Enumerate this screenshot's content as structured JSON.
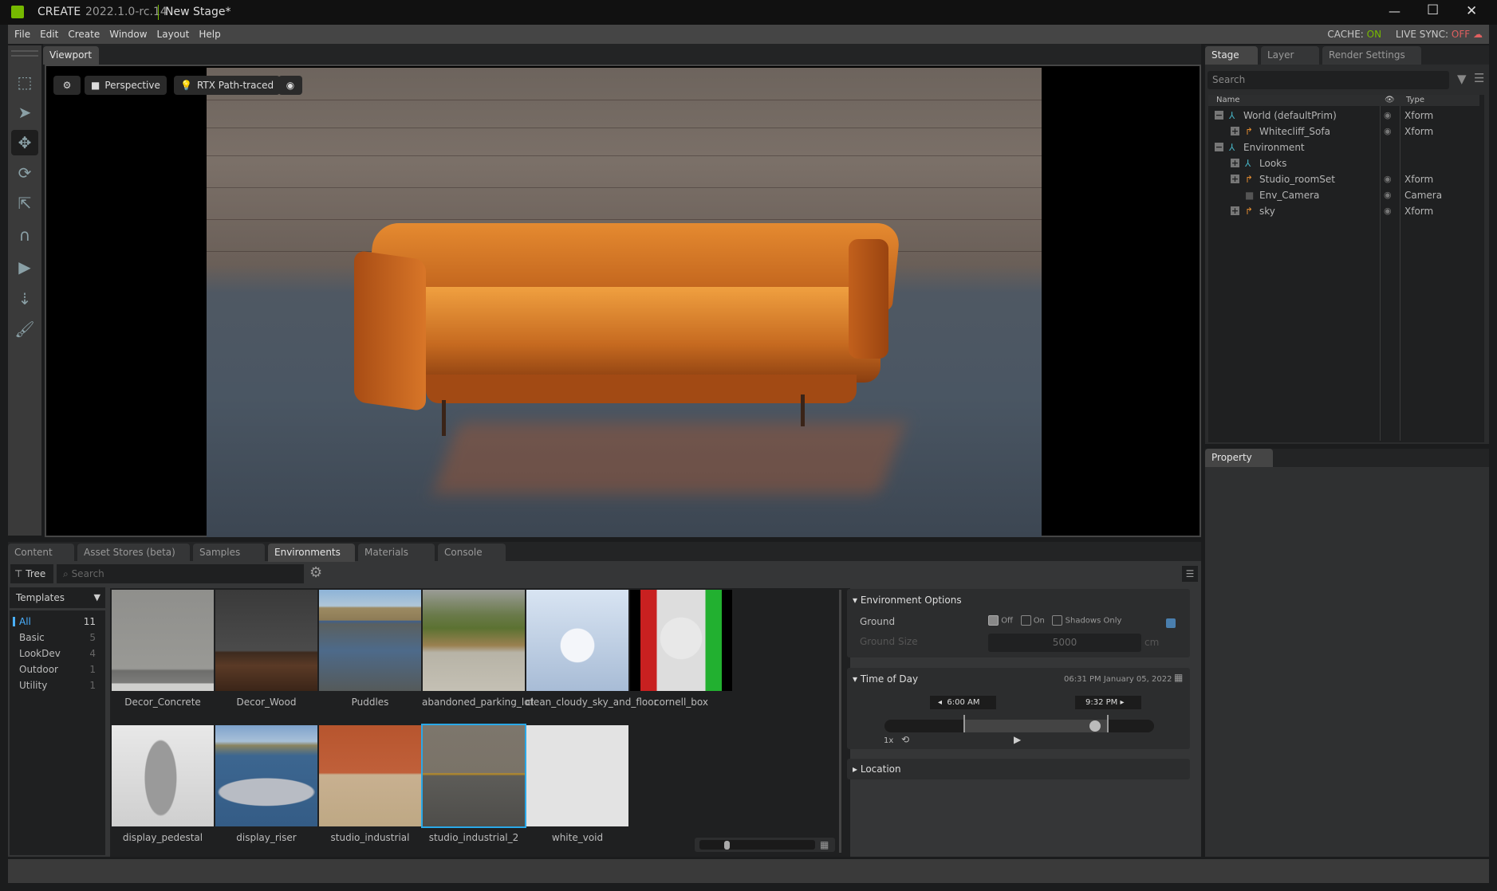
{
  "titlebar": {
    "app": "CREATE",
    "version": "2022.1.0-rc.14",
    "document": "New Stage*",
    "minimize": "—",
    "maximize": "☐",
    "close": "✕"
  },
  "menu": [
    "File",
    "Edit",
    "Create",
    "Window",
    "Layout",
    "Help"
  ],
  "status": {
    "cache_label": "CACHE:",
    "cache_value": "ON",
    "sync_label": "LIVE SYNC:",
    "sync_value": "OFF",
    "cache_color": "#76b900",
    "sync_color": "#e06060"
  },
  "viewport": {
    "tab": "Viewport",
    "camera": "Perspective",
    "renderer": "RTX Path-traced"
  },
  "toolbar_icons": [
    "frame-icon",
    "select-icon",
    "move-icon",
    "rotate-icon",
    "scale-icon",
    "snap-icon",
    "play-icon",
    "drop-icon",
    "paint-icon"
  ],
  "stage": {
    "tabs": [
      "Stage",
      "Layer",
      "Render Settings"
    ],
    "search_placeholder": "Search",
    "col_name": "Name",
    "col_type": "Type",
    "rows": [
      {
        "name": "World (defaultPrim)",
        "type": "Xform",
        "visible": true,
        "expander": "−",
        "level": 0,
        "icon": "xform"
      },
      {
        "name": "Whitecliff_Sofa",
        "type": "Xform",
        "visible": true,
        "expander": "+",
        "level": 1,
        "icon": "ref"
      },
      {
        "name": "Environment",
        "type": "",
        "visible": false,
        "expander": "−",
        "level": 0,
        "icon": "xform"
      },
      {
        "name": "Looks",
        "type": "",
        "visible": false,
        "expander": "+",
        "level": 1,
        "icon": "xform"
      },
      {
        "name": "Studio_roomSet",
        "type": "Xform",
        "visible": true,
        "expander": "+",
        "level": 1,
        "icon": "ref"
      },
      {
        "name": "Env_Camera",
        "type": "Camera",
        "visible": true,
        "expander": "",
        "level": 1,
        "icon": "camera"
      },
      {
        "name": "sky",
        "type": "Xform",
        "visible": true,
        "expander": "+",
        "level": 1,
        "icon": "ref"
      }
    ]
  },
  "property": {
    "tab": "Property"
  },
  "content": {
    "tabs": [
      "Content",
      "Asset Stores (beta)",
      "Samples",
      "Environments",
      "Materials",
      "Console"
    ],
    "active_tab": 3,
    "tree_label": "Tree",
    "search_placeholder": "Search",
    "dropdown": "Templates",
    "categories": [
      {
        "name": "All",
        "count": "11"
      },
      {
        "name": "Basic",
        "count": "5"
      },
      {
        "name": "LookDev",
        "count": "4"
      },
      {
        "name": "Outdoor",
        "count": "1"
      },
      {
        "name": "Utility",
        "count": "1"
      }
    ],
    "items": [
      {
        "name": "Decor_Concrete",
        "thumb": "concrete"
      },
      {
        "name": "Decor_Wood",
        "thumb": "wood"
      },
      {
        "name": "Puddles",
        "thumb": "puddles"
      },
      {
        "name": "abandoned_parking_lot",
        "thumb": "parking"
      },
      {
        "name": "clean_cloudy_sky_and_floor",
        "thumb": "cloudy"
      },
      {
        "name": "cornell_box",
        "thumb": "cornell"
      },
      {
        "name": "display_pedestal",
        "thumb": "pedestal"
      },
      {
        "name": "display_riser",
        "thumb": "riser"
      },
      {
        "name": "studio_industrial",
        "thumb": "industrial"
      },
      {
        "name": "studio_industrial_2",
        "thumb": "industrial2",
        "selected": true
      },
      {
        "name": "white_void",
        "thumb": "white"
      }
    ]
  },
  "env": {
    "options_title": "Environment Options",
    "ground_label": "Ground",
    "off": "Off",
    "on": "On",
    "shadows_only": "Shadows Only",
    "ground_size_label": "Ground Size",
    "ground_size": "5000",
    "unit": "cm",
    "tod_title": "Time of Day",
    "datetime": "06:31 PM  January 05, 2022",
    "sunrise": "6:00  AM",
    "sunset": "9:32  PM",
    "speed": "1x",
    "time_fraction": 0.78,
    "location_title": "Location"
  }
}
